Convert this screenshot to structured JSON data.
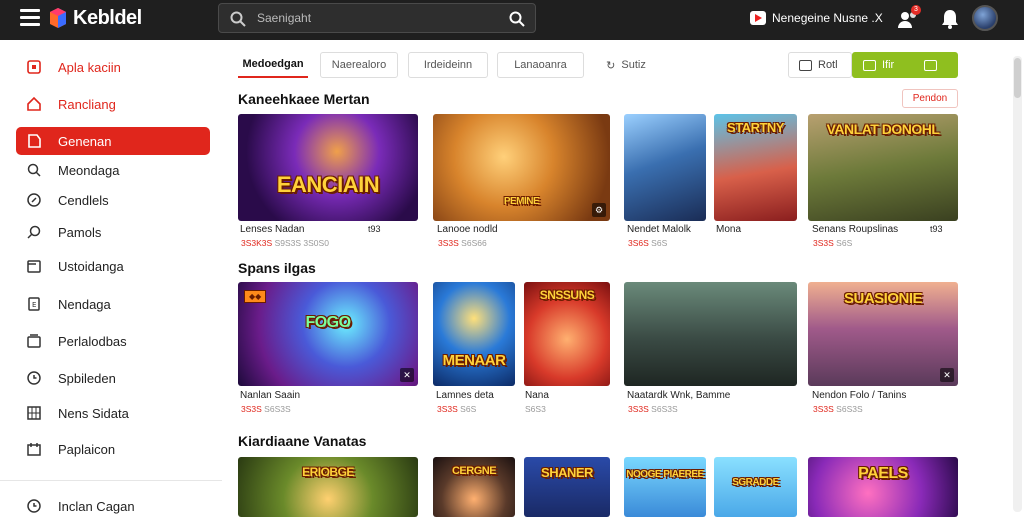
{
  "header": {
    "app_name": "Kebldel",
    "search_placeholder": "Saenigaht",
    "channel_label": "Nenegeine Nusne .X",
    "notification_count": "3"
  },
  "sidebar": {
    "items": [
      {
        "label": "Apla kaciin",
        "icon": "square-icon"
      },
      {
        "label": "Rancliang",
        "icon": "home-icon"
      },
      {
        "label": "Genenan",
        "icon": "tag-icon"
      },
      {
        "label": "Meondaga",
        "icon": "search-icon"
      },
      {
        "label": "Cendlels",
        "icon": "compass-icon"
      },
      {
        "label": "Pamols",
        "icon": "pin-icon"
      },
      {
        "label": "Ustoidanga",
        "icon": "folder-icon"
      },
      {
        "label": "Nendaga",
        "icon": "book-icon"
      },
      {
        "label": "Perlalodbas",
        "icon": "list-icon"
      },
      {
        "label": "Spbileden",
        "icon": "clock-icon"
      },
      {
        "label": "Nens Sidata",
        "icon": "grid-icon"
      },
      {
        "label": "Paplaicon",
        "icon": "calendar-icon"
      },
      {
        "label": "Inclan Cagan",
        "icon": "clock-icon"
      }
    ]
  },
  "filters": {
    "tabs": [
      "Medoedgan",
      "Naerealoro",
      "Irdeideinn",
      "Lanaoanra",
      "Sutiz"
    ],
    "view_list_label": "Rotl",
    "view_grid_label": "Ifir"
  },
  "sections": [
    {
      "title": "Kaneehkaee Mertan",
      "see_all": "Pendon",
      "cards": [
        {
          "caption": "Lenses Nadan",
          "meta1": "3S3K3S",
          "meta2": "S9S3S 3S0S0",
          "extra": "t93",
          "art_title": "EANCIAIN"
        },
        {
          "caption": "Lanooe nodld",
          "meta1": "3S3S",
          "meta2": "S6S66",
          "extra": "",
          "art_title": "PEMINE"
        },
        {
          "caption": "Nendet Malolk",
          "meta1": "3S6S",
          "meta2": "S6S",
          "extra": "",
          "art_title": ""
        },
        {
          "caption": "Mona",
          "meta1": "",
          "meta2": "",
          "extra": "",
          "art_title": "STARTNY"
        },
        {
          "caption": "Senans Roupslinas",
          "meta1": "3S3S",
          "meta2": "S6S",
          "extra": "t93",
          "art_title": "VANLAT DONOHL"
        }
      ]
    },
    {
      "title": "Spans ilgas",
      "cards": [
        {
          "caption": "Nanlan Saain",
          "meta1": "3S3S",
          "meta2": "S6S3S",
          "extra": "",
          "art_title": "FOGO"
        },
        {
          "caption": "Lamnes deta",
          "meta1": "3S3S",
          "meta2": "S6S",
          "extra": "",
          "art_title": "MENAAR"
        },
        {
          "caption": "Nana",
          "meta1": "",
          "meta2": "S6S3",
          "extra": "",
          "art_title": "SNSSUNS"
        },
        {
          "caption": "Naatardk Wnk, Bamme",
          "meta1": "3S3S",
          "meta2": "S6S3S",
          "extra": "",
          "art_title": ""
        },
        {
          "caption": "Nendon Folo / Tanins",
          "meta1": "3S3S",
          "meta2": "S6S3S",
          "extra": "",
          "art_title": "SUASIONIE"
        }
      ]
    },
    {
      "title": "Kiardiaane Vanatas",
      "cards": [
        {
          "art_title": "ERIOBGE"
        },
        {
          "art_title": "CERGNE"
        },
        {
          "art_title": "SHANER"
        },
        {
          "art_title": "NOOGE PIAEREE"
        },
        {
          "art_title": "SGRADDE"
        },
        {
          "art_title": "PAELS"
        }
      ]
    }
  ],
  "colors": {
    "accent": "#e0261c",
    "topbar": "#1f1f1f",
    "green": "#8fbf1f"
  }
}
